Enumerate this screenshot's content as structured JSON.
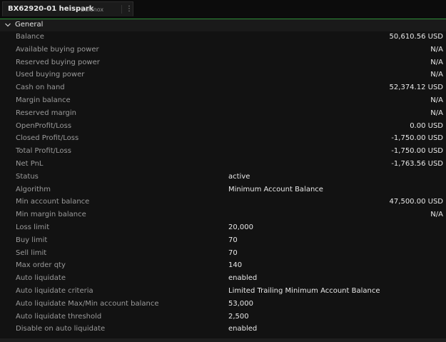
{
  "tab": {
    "title": "BX62920-01 heispark",
    "subtitle": "Bulenox",
    "menu_icon": "vertical-ellipsis-icon"
  },
  "section": {
    "label": "General",
    "icon": "chevron-down-icon"
  },
  "rows": [
    {
      "label": "Balance",
      "value": "50,610.56 USD",
      "align": "right"
    },
    {
      "label": "Available buying power",
      "value": "N/A",
      "align": "right"
    },
    {
      "label": "Reserved buying power",
      "value": "N/A",
      "align": "right"
    },
    {
      "label": "Used buying power",
      "value": "N/A",
      "align": "right"
    },
    {
      "label": "Cash on hand",
      "value": "52,374.12 USD",
      "align": "right"
    },
    {
      "label": "Margin balance",
      "value": "N/A",
      "align": "right"
    },
    {
      "label": "Reserved margin",
      "value": "N/A",
      "align": "right"
    },
    {
      "label": "OpenProfit/Loss",
      "value": "0.00 USD",
      "align": "right"
    },
    {
      "label": "Closed Profit/Loss",
      "value": "-1,750.00 USD",
      "align": "right"
    },
    {
      "label": "Total Profit/Loss",
      "value": "-1,750.00 USD",
      "align": "right"
    },
    {
      "label": "Net PnL",
      "value": "-1,763.56 USD",
      "align": "right"
    },
    {
      "label": "Status",
      "value": "active",
      "align": "left"
    },
    {
      "label": "Algorithm",
      "value": "Minimum Account Balance",
      "align": "left"
    },
    {
      "label": "Min account balance",
      "value": "47,500.00 USD",
      "align": "right"
    },
    {
      "label": "Min margin balance",
      "value": "N/A",
      "align": "right"
    },
    {
      "label": "Loss limit",
      "value": "20,000",
      "align": "left"
    },
    {
      "label": "Buy limit",
      "value": "70",
      "align": "left"
    },
    {
      "label": "Sell limit",
      "value": "70",
      "align": "left"
    },
    {
      "label": "Max order qty",
      "value": "140",
      "align": "left"
    },
    {
      "label": "Auto liquidate",
      "value": "enabled",
      "align": "left"
    },
    {
      "label": "Auto liquidate criteria",
      "value": "Limited Trailing Minimum Account Balance",
      "align": "left"
    },
    {
      "label": "Auto liquidate Max/Min account balance",
      "value": "53,000",
      "align": "left"
    },
    {
      "label": "Auto liquidate threshold",
      "value": "2,500",
      "align": "left"
    },
    {
      "label": "Disable on auto liquidate",
      "value": "enabled",
      "align": "left"
    }
  ],
  "colors": {
    "accent": "#2f8f3a",
    "label": "#9a9a9a",
    "value": "#e8e8e8"
  }
}
